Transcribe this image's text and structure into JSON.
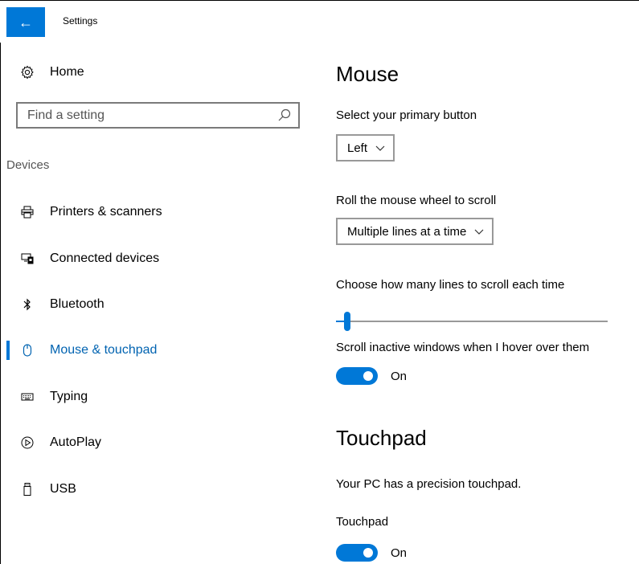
{
  "window": {
    "title": "Settings",
    "back_icon": "←"
  },
  "sidebar": {
    "home_label": "Home",
    "search": {
      "placeholder": "Find a setting",
      "value": ""
    },
    "section_header": "Devices",
    "items": [
      {
        "label": "Printers & scanners",
        "icon": "printer-icon",
        "active": false
      },
      {
        "label": "Connected devices",
        "icon": "connected-devices-icon",
        "active": false
      },
      {
        "label": "Bluetooth",
        "icon": "bluetooth-icon",
        "active": false
      },
      {
        "label": "Mouse & touchpad",
        "icon": "mouse-icon",
        "active": true
      },
      {
        "label": "Typing",
        "icon": "keyboard-icon",
        "active": false
      },
      {
        "label": "AutoPlay",
        "icon": "autoplay-icon",
        "active": false
      },
      {
        "label": "USB",
        "icon": "usb-icon",
        "active": false
      }
    ]
  },
  "content": {
    "mouse_heading": "Mouse",
    "primary_button_label": "Select your primary button",
    "primary_button_value": "Left",
    "scroll_wheel_label": "Roll the mouse wheel to scroll",
    "scroll_wheel_value": "Multiple lines at a time",
    "lines_to_scroll_label": "Choose how many lines to scroll each time",
    "lines_to_scroll_fraction": 0.03,
    "scroll_inactive_label": "Scroll inactive windows when I hover over them",
    "scroll_inactive_state": "On",
    "touchpad_heading": "Touchpad",
    "precision_text": "Your PC has a precision touchpad.",
    "touchpad_label": "Touchpad",
    "touchpad_state": "On"
  },
  "colors": {
    "accent": "#0078d7",
    "accent_text": "#0063b1"
  }
}
